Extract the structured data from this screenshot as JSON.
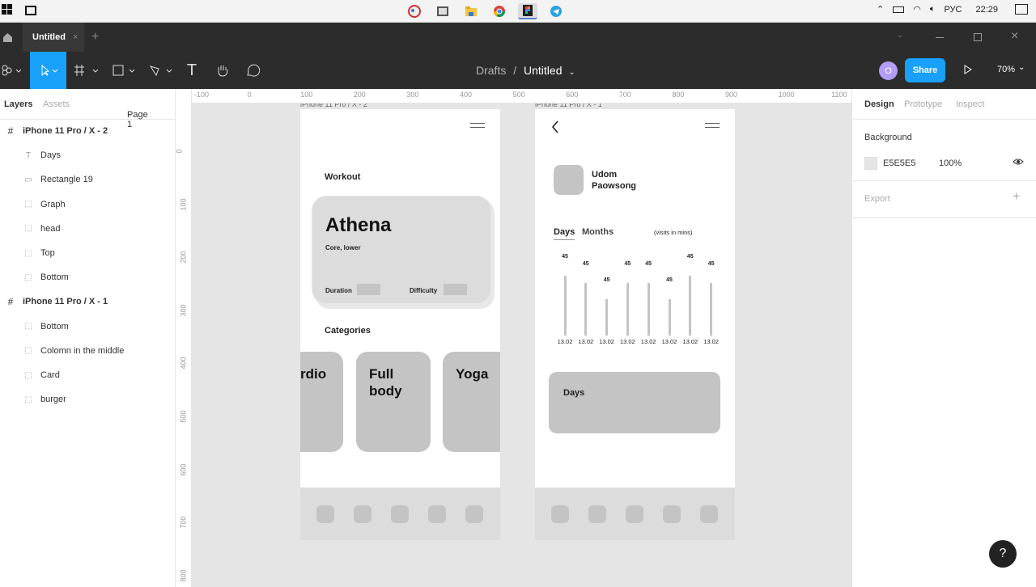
{
  "taskbar": {
    "lang": "РУС",
    "time": "22:29"
  },
  "tab": {
    "title": "Untitled",
    "close": "×",
    "add": "+"
  },
  "toolbar": {
    "drafts": "Drafts",
    "sep": "/",
    "file": "Untitled",
    "avatar": "O",
    "share": "Share",
    "zoom": "70%"
  },
  "left": {
    "tab_layers": "Layers",
    "tab_assets": "Assets",
    "page": "Page 1",
    "layers": [
      {
        "name": "iPhone 11 Pro / X - 2",
        "icon": "frame",
        "indent": 0
      },
      {
        "name": "Days",
        "icon": "text",
        "indent": 1
      },
      {
        "name": "Rectangle 19",
        "icon": "rect",
        "indent": 1
      },
      {
        "name": "Graph",
        "icon": "group",
        "indent": 1
      },
      {
        "name": "head",
        "icon": "group",
        "indent": 1
      },
      {
        "name": "Top",
        "icon": "group",
        "indent": 1
      },
      {
        "name": "Bottom",
        "icon": "group",
        "indent": 1
      },
      {
        "name": "iPhone 11 Pro / X - 1",
        "icon": "frame",
        "indent": 0
      },
      {
        "name": "Bottom",
        "icon": "group",
        "indent": 1
      },
      {
        "name": "Colomn in the middle",
        "icon": "group",
        "indent": 1
      },
      {
        "name": "Card",
        "icon": "group",
        "indent": 1
      },
      {
        "name": "burger",
        "icon": "group",
        "indent": 1
      }
    ]
  },
  "ruler": {
    "top": [
      "-100",
      "0",
      "100",
      "200",
      "300",
      "400",
      "500",
      "600",
      "700",
      "800",
      "900",
      "1000",
      "1100"
    ],
    "left": [
      "0",
      "100",
      "200",
      "300",
      "400",
      "500",
      "600",
      "700",
      "800"
    ]
  },
  "frame1": {
    "workout": "Workout",
    "card_title": "Athena",
    "card_sub": "Core, lower",
    "duration": "Duration",
    "difficulty": "Difficulty",
    "categories": "Categories",
    "cat1": "rdio",
    "cat2a": "Full",
    "cat2b": "body",
    "cat3": "Yoga"
  },
  "frame2": {
    "name1": "Udom",
    "name2": "Paowsong",
    "tab_days": "Days",
    "tab_months": "Months",
    "note": "(visits in mins)",
    "card": "Days",
    "bar_values": [
      "45",
      "45",
      "45",
      "45",
      "45",
      "45",
      "45",
      "45"
    ],
    "bar_dates": [
      "13.02",
      "13.02",
      "13.02",
      "13.02",
      "13.02",
      "13.02",
      "13.02",
      "13.02"
    ]
  },
  "right": {
    "tab_design": "Design",
    "tab_prototype": "Prototype",
    "tab_inspect": "Inspect",
    "background": "Background",
    "hex": "E5E5E5",
    "opacity": "100%",
    "export": "Export",
    "help": "?"
  }
}
